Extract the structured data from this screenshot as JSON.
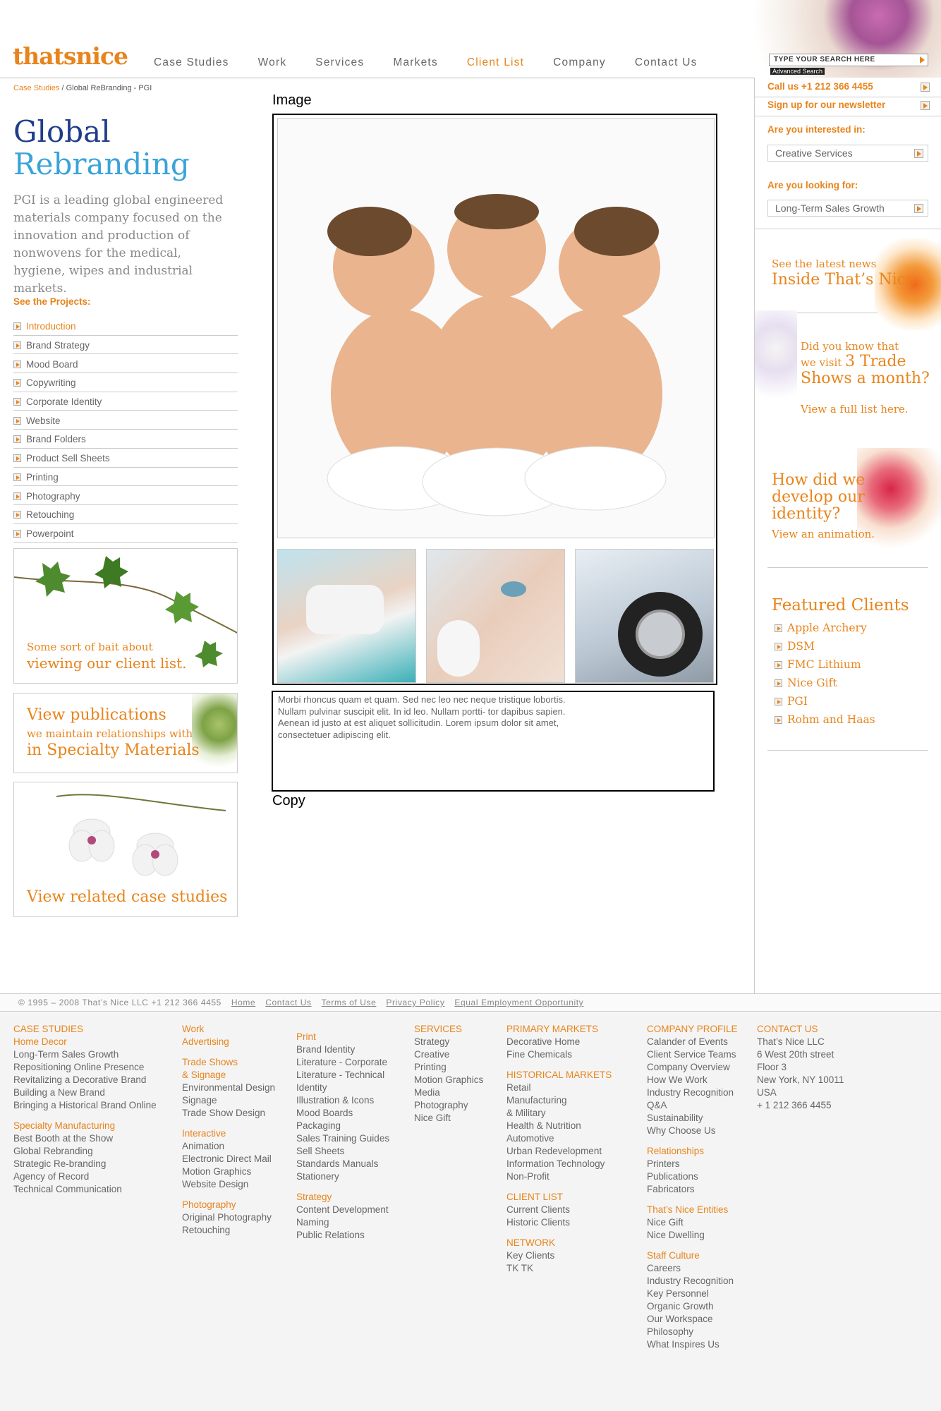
{
  "header": {
    "logo": "thatsnice",
    "nav": [
      "Case Studies",
      "Work",
      "Services",
      "Markets",
      "Client List",
      "Company",
      "Contact Us"
    ],
    "active_nav": "Client List",
    "search_placeholder": "TYPE YOUR SEARCH HERE",
    "advanced_search": "Advanced Search"
  },
  "breadcrumb": {
    "root": "Case Studies",
    "separator": " / ",
    "current": "Global ReBranding - PGI"
  },
  "page": {
    "title_line1": "Global",
    "title_line2": "Rebranding",
    "intro": "PGI is a leading global engineered materials company focused on the innovation and production of nonwovens for the medical, hygiene, wipes and industrial markets.",
    "see_projects": "See the Projects:",
    "projects": [
      "Introduction",
      "Brand Strategy",
      "Mood Board",
      "Copywriting",
      "Corporate Identity",
      "Website",
      "Brand Folders",
      "Product Sell Sheets",
      "Printing",
      "Photography",
      "Retouching",
      "Powerpoint"
    ]
  },
  "promos": {
    "client_line1": "Some sort of bait about",
    "client_line2": "viewing our client list.",
    "pub_line1": "View publications",
    "pub_line2": "we maintain relationships with",
    "pub_line3": "in Specialty Materials",
    "related": "View related case studies"
  },
  "center": {
    "image_label": "Image",
    "copy_label": "Copy",
    "copy_text": "Morbi rhoncus quam et quam. Sed nec leo nec neque tristique lobortis. Nullam pulvinar suscipit elit. In id leo. Nullam portti- tor dapibus sapien. Aenean id justo at est aliquet sollicitudin. Lorem ipsum dolor sit amet, consectetuer adipiscing elit."
  },
  "right": {
    "call": "Call us +1 212 366 4455",
    "newsletter": "Sign up for our newsletter",
    "interested_label": "Are you interested in:",
    "interested_value": "Creative Services",
    "looking_label": "Are you looking for:",
    "looking_value": "Long-Term Sales Growth",
    "news_line1": "See the latest news",
    "news_line2": "Inside That’s Nice",
    "trade_line1": "Did you know that",
    "trade_line2a": "we visit",
    "trade_line2b": "3 Trade",
    "trade_line3": "Shows a month?",
    "trade_line4": "View a full list here.",
    "identity_line1": "How did we",
    "identity_line2": "develop our",
    "identity_line3": "identity?",
    "identity_line4": "View an animation.",
    "featured_title": "Featured Clients",
    "featured": [
      "Apple Archery",
      "DSM",
      "FMC Lithium",
      "Nice Gift",
      "PGI",
      "Rohm and Haas"
    ]
  },
  "footer_bar": {
    "copyright": "© 1995 – 2008 That’s Nice LLC  +1 212 366 4455",
    "links": [
      "Home",
      "Contact Us",
      "Terms of Use",
      "Privacy Policy",
      "Equal Employment Opportunity"
    ]
  },
  "footer": {
    "col1": [
      {
        "h": "CASE STUDIES"
      },
      {
        "h": "Home Decor"
      },
      {
        "t": "Long-Term Sales Growth"
      },
      {
        "t": "Repositioning Online Presence"
      },
      {
        "t": "Revitalizing a Decorative Brand"
      },
      {
        "t": "Building a New Brand"
      },
      {
        "t": "Bringing a Historical Brand Online"
      },
      {
        "g": 1
      },
      {
        "h": "Specialty Manufacturing"
      },
      {
        "t": "Best Booth at the Show"
      },
      {
        "t": "Global Rebranding"
      },
      {
        "t": "Strategic Re-branding"
      },
      {
        "t": "Agency of Record"
      },
      {
        "t": "Technical Communication"
      }
    ],
    "col2": [
      {
        "h": "Work"
      },
      {
        "h": "Advertising"
      },
      {
        "g": 1
      },
      {
        "h": "Trade Shows"
      },
      {
        "h": "& Signage"
      },
      {
        "t": "Environmental Design"
      },
      {
        "t": "Signage"
      },
      {
        "t": "Trade Show Design"
      },
      {
        "g": 1
      },
      {
        "h": "Interactive"
      },
      {
        "t": "Animation"
      },
      {
        "t": "Electronic Direct Mail"
      },
      {
        "t": "Motion Graphics"
      },
      {
        "t": "Website Design"
      },
      {
        "g": 1
      },
      {
        "h": "Photography"
      },
      {
        "t": "Original Photography"
      },
      {
        "t": "Retouching"
      }
    ],
    "col3": [
      {
        "g": 1
      },
      {
        "h": "Print"
      },
      {
        "t": "Brand Identity"
      },
      {
        "t": "Literature - Corporate"
      },
      {
        "t": "Literature - Technical"
      },
      {
        "t": "Identity"
      },
      {
        "t": "Illustration & Icons"
      },
      {
        "t": "Mood Boards"
      },
      {
        "t": "Packaging"
      },
      {
        "t": "Sales Training Guides"
      },
      {
        "t": "Sell Sheets"
      },
      {
        "t": "Standards Manuals"
      },
      {
        "t": "Stationery"
      },
      {
        "g": 1
      },
      {
        "h": "Strategy"
      },
      {
        "t": "Content Development"
      },
      {
        "t": "Naming"
      },
      {
        "t": "Public Relations"
      }
    ],
    "col4": [
      {
        "h": "SERVICES"
      },
      {
        "t": "Strategy"
      },
      {
        "t": "Creative"
      },
      {
        "t": "Printing"
      },
      {
        "t": "Motion Graphics"
      },
      {
        "t": "Media"
      },
      {
        "t": "Photography"
      },
      {
        "t": "Nice Gift"
      }
    ],
    "col5": [
      {
        "h": "PRIMARY MARKETS"
      },
      {
        "t": "Decorative Home"
      },
      {
        "t": "Fine Chemicals"
      },
      {
        "g": 1
      },
      {
        "h": "HISTORICAL MARKETS"
      },
      {
        "t": "Retail"
      },
      {
        "t": "Manufacturing"
      },
      {
        "t": "& Military"
      },
      {
        "t": "Health & Nutrition"
      },
      {
        "t": "Automotive"
      },
      {
        "t": "Urban Redevelopment"
      },
      {
        "t": "Information Technology"
      },
      {
        "t": "Non-Profit"
      },
      {
        "g": 1
      },
      {
        "h": "CLIENT LIST"
      },
      {
        "t": "Current Clients"
      },
      {
        "t": "Historic Clients"
      },
      {
        "g": 1
      },
      {
        "h": "NETWORK"
      },
      {
        "t": "Key Clients"
      },
      {
        "t": "TK TK"
      }
    ],
    "col6": [
      {
        "h": "COMPANY PROFILE"
      },
      {
        "t": "Calander of Events"
      },
      {
        "t": "Client Service Teams"
      },
      {
        "t": "Company Overview"
      },
      {
        "t": "How We Work"
      },
      {
        "t": "Industry Recognition"
      },
      {
        "t": "Q&A"
      },
      {
        "t": "Sustainability"
      },
      {
        "t": "Why Choose Us"
      },
      {
        "g": 1
      },
      {
        "h": "Relationships"
      },
      {
        "t": "Printers"
      },
      {
        "t": "Publications"
      },
      {
        "t": "Fabricators"
      },
      {
        "g": 1
      },
      {
        "h": "That’s Nice Entities"
      },
      {
        "t": "Nice Gift"
      },
      {
        "t": "Nice Dwelling"
      },
      {
        "g": 1
      },
      {
        "h": "Staff Culture"
      },
      {
        "t": "Careers"
      },
      {
        "t": "Industry Recognition"
      },
      {
        "t": "Key Personnel"
      },
      {
        "t": "Organic Growth"
      },
      {
        "t": "Our Workspace"
      },
      {
        "t": "Philosophy"
      },
      {
        "t": "What Inspires Us"
      }
    ],
    "col7": [
      {
        "h": "CONTACT US"
      },
      {
        "t": "That’s Nice LLC"
      },
      {
        "t": "6 West 20th street"
      },
      {
        "t": "Floor 3"
      },
      {
        "t": "New York, NY 10011"
      },
      {
        "t": "USA"
      },
      {
        "t": "+ 1 212 366 4455"
      }
    ]
  }
}
